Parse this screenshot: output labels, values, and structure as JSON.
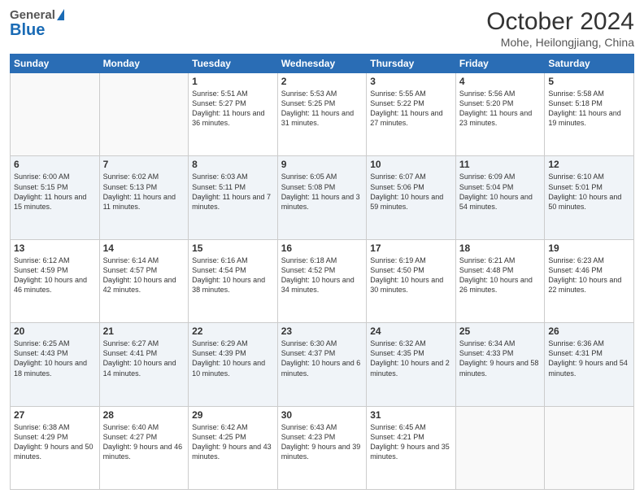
{
  "header": {
    "logo_general": "General",
    "logo_blue": "Blue",
    "month_title": "October 2024",
    "location": "Mohe, Heilongjiang, China"
  },
  "days_of_week": [
    "Sunday",
    "Monday",
    "Tuesday",
    "Wednesday",
    "Thursday",
    "Friday",
    "Saturday"
  ],
  "weeks": [
    [
      {
        "day": "",
        "info": ""
      },
      {
        "day": "",
        "info": ""
      },
      {
        "day": "1",
        "info": "Sunrise: 5:51 AM\nSunset: 5:27 PM\nDaylight: 11 hours and 36 minutes."
      },
      {
        "day": "2",
        "info": "Sunrise: 5:53 AM\nSunset: 5:25 PM\nDaylight: 11 hours and 31 minutes."
      },
      {
        "day": "3",
        "info": "Sunrise: 5:55 AM\nSunset: 5:22 PM\nDaylight: 11 hours and 27 minutes."
      },
      {
        "day": "4",
        "info": "Sunrise: 5:56 AM\nSunset: 5:20 PM\nDaylight: 11 hours and 23 minutes."
      },
      {
        "day": "5",
        "info": "Sunrise: 5:58 AM\nSunset: 5:18 PM\nDaylight: 11 hours and 19 minutes."
      }
    ],
    [
      {
        "day": "6",
        "info": "Sunrise: 6:00 AM\nSunset: 5:15 PM\nDaylight: 11 hours and 15 minutes."
      },
      {
        "day": "7",
        "info": "Sunrise: 6:02 AM\nSunset: 5:13 PM\nDaylight: 11 hours and 11 minutes."
      },
      {
        "day": "8",
        "info": "Sunrise: 6:03 AM\nSunset: 5:11 PM\nDaylight: 11 hours and 7 minutes."
      },
      {
        "day": "9",
        "info": "Sunrise: 6:05 AM\nSunset: 5:08 PM\nDaylight: 11 hours and 3 minutes."
      },
      {
        "day": "10",
        "info": "Sunrise: 6:07 AM\nSunset: 5:06 PM\nDaylight: 10 hours and 59 minutes."
      },
      {
        "day": "11",
        "info": "Sunrise: 6:09 AM\nSunset: 5:04 PM\nDaylight: 10 hours and 54 minutes."
      },
      {
        "day": "12",
        "info": "Sunrise: 6:10 AM\nSunset: 5:01 PM\nDaylight: 10 hours and 50 minutes."
      }
    ],
    [
      {
        "day": "13",
        "info": "Sunrise: 6:12 AM\nSunset: 4:59 PM\nDaylight: 10 hours and 46 minutes."
      },
      {
        "day": "14",
        "info": "Sunrise: 6:14 AM\nSunset: 4:57 PM\nDaylight: 10 hours and 42 minutes."
      },
      {
        "day": "15",
        "info": "Sunrise: 6:16 AM\nSunset: 4:54 PM\nDaylight: 10 hours and 38 minutes."
      },
      {
        "day": "16",
        "info": "Sunrise: 6:18 AM\nSunset: 4:52 PM\nDaylight: 10 hours and 34 minutes."
      },
      {
        "day": "17",
        "info": "Sunrise: 6:19 AM\nSunset: 4:50 PM\nDaylight: 10 hours and 30 minutes."
      },
      {
        "day": "18",
        "info": "Sunrise: 6:21 AM\nSunset: 4:48 PM\nDaylight: 10 hours and 26 minutes."
      },
      {
        "day": "19",
        "info": "Sunrise: 6:23 AM\nSunset: 4:46 PM\nDaylight: 10 hours and 22 minutes."
      }
    ],
    [
      {
        "day": "20",
        "info": "Sunrise: 6:25 AM\nSunset: 4:43 PM\nDaylight: 10 hours and 18 minutes."
      },
      {
        "day": "21",
        "info": "Sunrise: 6:27 AM\nSunset: 4:41 PM\nDaylight: 10 hours and 14 minutes."
      },
      {
        "day": "22",
        "info": "Sunrise: 6:29 AM\nSunset: 4:39 PM\nDaylight: 10 hours and 10 minutes."
      },
      {
        "day": "23",
        "info": "Sunrise: 6:30 AM\nSunset: 4:37 PM\nDaylight: 10 hours and 6 minutes."
      },
      {
        "day": "24",
        "info": "Sunrise: 6:32 AM\nSunset: 4:35 PM\nDaylight: 10 hours and 2 minutes."
      },
      {
        "day": "25",
        "info": "Sunrise: 6:34 AM\nSunset: 4:33 PM\nDaylight: 9 hours and 58 minutes."
      },
      {
        "day": "26",
        "info": "Sunrise: 6:36 AM\nSunset: 4:31 PM\nDaylight: 9 hours and 54 minutes."
      }
    ],
    [
      {
        "day": "27",
        "info": "Sunrise: 6:38 AM\nSunset: 4:29 PM\nDaylight: 9 hours and 50 minutes."
      },
      {
        "day": "28",
        "info": "Sunrise: 6:40 AM\nSunset: 4:27 PM\nDaylight: 9 hours and 46 minutes."
      },
      {
        "day": "29",
        "info": "Sunrise: 6:42 AM\nSunset: 4:25 PM\nDaylight: 9 hours and 43 minutes."
      },
      {
        "day": "30",
        "info": "Sunrise: 6:43 AM\nSunset: 4:23 PM\nDaylight: 9 hours and 39 minutes."
      },
      {
        "day": "31",
        "info": "Sunrise: 6:45 AM\nSunset: 4:21 PM\nDaylight: 9 hours and 35 minutes."
      },
      {
        "day": "",
        "info": ""
      },
      {
        "day": "",
        "info": ""
      }
    ]
  ]
}
